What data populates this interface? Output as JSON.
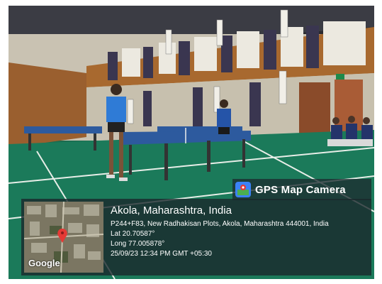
{
  "stamp": {
    "app_name": "GPS Map Camera",
    "place": "Akola, Maharashtra, India",
    "address": "P244+F83, New Radhakisan Plots, Akola, Maharashtra 444001, India",
    "lat": "Lat 20.70587°",
    "long": "Long 77.005878°",
    "datetime": "25/09/23 12:34 PM GMT +05:30",
    "map_brand": "Google"
  },
  "colors": {
    "floor": "#1b7a5a",
    "wall_orange": "#b5723c",
    "table_blue": "#2d5a9e",
    "shirt_blue": "#2f7bd6"
  }
}
